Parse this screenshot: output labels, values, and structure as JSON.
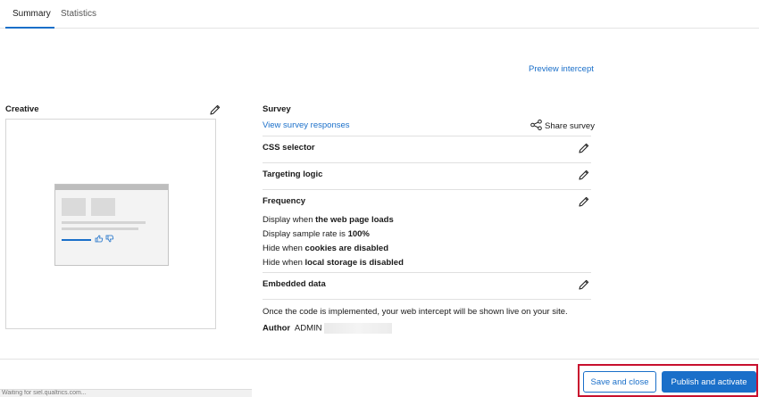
{
  "tabs": [
    {
      "label": "Summary",
      "active": true
    },
    {
      "label": "Statistics",
      "active": false
    }
  ],
  "preview_link": "Preview intercept",
  "creative": {
    "title": "Creative"
  },
  "survey": {
    "title": "Survey",
    "view_responses": "View survey responses",
    "share_label": "Share survey"
  },
  "sections": {
    "css_selector": "CSS selector",
    "targeting_logic": "Targeting logic",
    "frequency": "Frequency",
    "embedded_data": "Embedded data"
  },
  "frequency": {
    "line1_prefix": "Display when ",
    "line1_bold": "the web page loads",
    "line2_prefix": "Display sample rate is ",
    "line2_bold": "100%",
    "line3_prefix": "Hide when ",
    "line3_bold": "cookies are disabled",
    "line4_prefix": "Hide when ",
    "line4_bold": "local storage is disabled"
  },
  "note": "Once the code is implemented, your web intercept will be shown live on your site.",
  "author": {
    "label": "Author",
    "name": "ADMIN"
  },
  "buttons": {
    "save": "Save and close",
    "publish": "Publish and activate"
  },
  "status_bar": "Waiting for siel.qualtrics.com...",
  "colors": {
    "accent": "#1a6fc9",
    "highlight": "#c8102e"
  },
  "icons": {
    "edit": "pencil-icon",
    "share": "share-icon",
    "thumbs": "thumbs-up-down-icon"
  }
}
